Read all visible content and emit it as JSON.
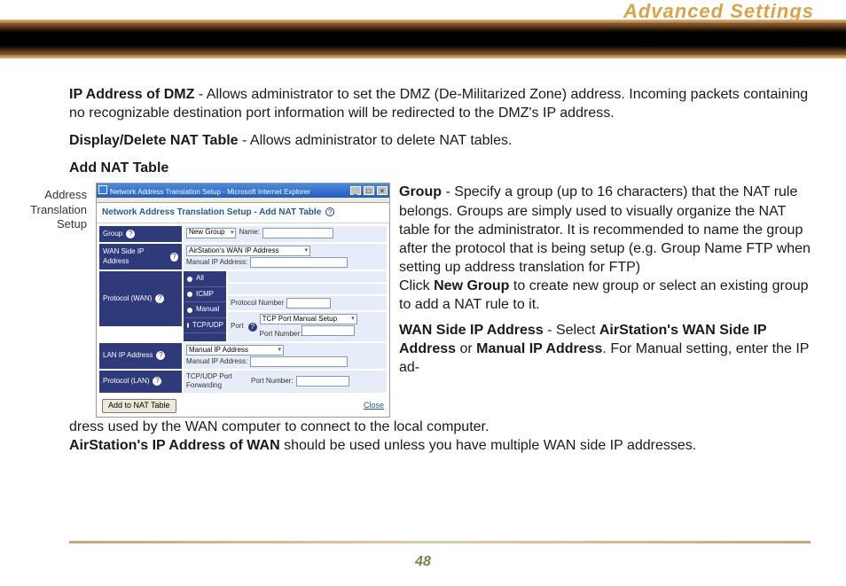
{
  "page": {
    "title": "Advanced Settings",
    "number": "48"
  },
  "body": {
    "p1_bold": "IP Address of DMZ",
    "p1_rest": " - Allows administrator to set the DMZ (De-Militarized Zone) address. Incoming packets containing no recognizable destination port information will be redirected to the DMZ's IP address.",
    "p2_bold": "Display/Delete NAT Table",
    "p2_rest": "  - Allows administrator to delete NAT tables.",
    "p3": "Add NAT Table",
    "caption_line1": "Address",
    "caption_line2": "Translation",
    "caption_line3": "Setup",
    "group_bold": "Group",
    "group_text": " - Specify a group (up to 16 characters) that the NAT rule belongs.   Groups are simply used to visually organize the NAT table for the administrator.  It is recommended to name the group after the protocol that is being setup (e.g. Group Name FTP when setting up address translation for FTP)",
    "click_pre": "Click ",
    "click_bold": "New Group",
    "click_post": " to create new group or select an existing group to add a NAT rule to it.",
    "wan_bold1": "WAN Side IP Address",
    "wan_dash": " - Select ",
    "wan_bold2": "AirStation's WAN Side IP Address",
    "wan_or": " or ",
    "wan_bold3": "Manual IP Address",
    "wan_post": ".  For Manual setting, enter the IP address used by the WAN computer to connect to the local computer.",
    "air_bold": "AirStation's IP Address of WAN",
    "air_post": " should be used unless you have multiple WAN side IP addresses."
  },
  "screenshot": {
    "window_title": "Network Address Translation Setup - Microsoft Internet Explorer",
    "heading_prefix": "Network Address Translation Setup - ",
    "heading_add": "Add NAT Table",
    "rows": {
      "group": "Group",
      "group_select": "New Group",
      "group_name_lbl": "Name:",
      "wan_ip": "WAN Side IP Address",
      "wan_select": "AirStation's WAN IP Address",
      "wan_manual_lbl": "Manual IP Address:",
      "protocol_wan": "Protocol (WAN)",
      "opt_all": "All",
      "opt_icmp": "ICMP",
      "opt_manual": "Manual",
      "opt_tcpudp": "TCP/UDP",
      "proto_num_lbl": "Protocol Number",
      "port_lbl": "Port",
      "port_select": "TCP Port Manual Setup",
      "port_num_lbl": "Port Number:",
      "lan_ip": "LAN IP Address",
      "lan_select": "Manual IP Address",
      "lan_manual_lbl": "Manual IP Address:",
      "protocol_lan": "Protocol (LAN)",
      "lan_port_lbl": "TCP/UDP Port Forwarding",
      "lan_port_num_lbl": "Port Number:"
    },
    "add_btn": "Add to NAT Table",
    "close": "Close",
    "q": "?",
    "win_min": "_",
    "win_max": "□",
    "win_close": "×"
  }
}
